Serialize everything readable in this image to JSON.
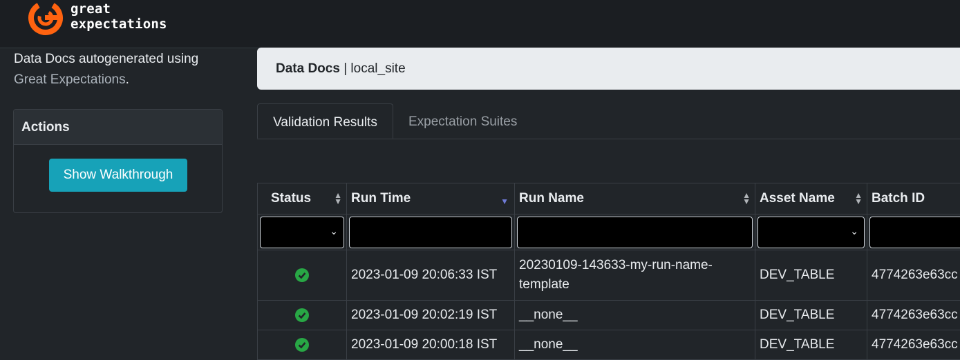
{
  "header": {
    "brand_line1": "great",
    "brand_line2": "expectations",
    "accent": "#ff6310"
  },
  "sidebar": {
    "description": "Data Docs autogenerated using",
    "link": "Great Expectations",
    "link_suffix": ".",
    "actions_title": "Actions",
    "walkthrough_button": "Show Walkthrough"
  },
  "breadcrumb": {
    "root": "Data Docs",
    "separator": " | ",
    "site": "local_site"
  },
  "tabs": [
    {
      "label": "Validation Results",
      "active": true
    },
    {
      "label": "Expectation Suites",
      "active": false
    }
  ],
  "table": {
    "columns": [
      "Status",
      "Run Time",
      "Run Name",
      "Asset Name",
      "Batch ID"
    ],
    "rows": [
      {
        "status": "success",
        "run_time": "2023-01-09 20:06:33 IST",
        "run_name": "20230109-143633-my-run-name-template",
        "asset_name": "DEV_TABLE",
        "batch_id": "4774263e63cc"
      },
      {
        "status": "success",
        "run_time": "2023-01-09 20:02:19 IST",
        "run_name": "__none__",
        "asset_name": "DEV_TABLE",
        "batch_id": "4774263e63cc"
      },
      {
        "status": "success",
        "run_time": "2023-01-09 20:00:18 IST",
        "run_name": "__none__",
        "asset_name": "DEV_TABLE",
        "batch_id": "4774263e63cc"
      }
    ]
  },
  "icons": {
    "status": "check-circle-icon",
    "sort": "sort-icon",
    "sort_desc": "sort-desc-icon",
    "chevron": "chevron-down-icon"
  },
  "colors": {
    "success": "#28a745",
    "button": "#17a2b8"
  }
}
